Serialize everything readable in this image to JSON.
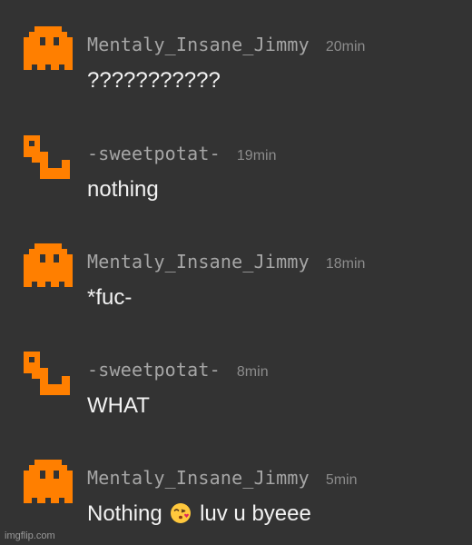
{
  "messages": [
    {
      "avatar": "pixel-ghost-icon",
      "username": "Mentaly_Insane_Jimmy",
      "time": "20min",
      "text": "???????????"
    },
    {
      "avatar": "pixel-hook-icon",
      "username": "-sweetpotat-",
      "time": "19min",
      "text": "nothing"
    },
    {
      "avatar": "pixel-ghost-icon",
      "username": "Mentaly_Insane_Jimmy",
      "time": "18min",
      "text": "*fuc-"
    },
    {
      "avatar": "pixel-hook-icon",
      "username": "-sweetpotat-",
      "time": "8min",
      "text": "WHAT"
    },
    {
      "avatar": "pixel-ghost-icon",
      "username": "Mentaly_Insane_Jimmy",
      "time": "5min",
      "text_before": "Nothing",
      "emoji": "kissing-face-emoji",
      "text_after": "luv u byeee"
    }
  ],
  "colors": {
    "background": "#333333",
    "avatar": "#ff7f00",
    "username": "#a6a6a6",
    "time": "#8c8c8c",
    "text": "#f2f2f2"
  },
  "watermark": "imgflip.com"
}
